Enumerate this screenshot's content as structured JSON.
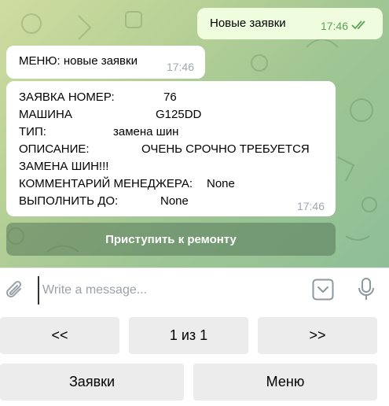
{
  "messages": {
    "outgoing": {
      "text": "Новые заявки",
      "time": "17:46"
    },
    "menu_message": {
      "text": "МЕНЮ: новые заявки",
      "time": "17:46"
    },
    "order_message": {
      "rows": [
        {
          "label": "ЗАЯВКА НОМЕР:",
          "value": "76"
        },
        {
          "label": "МАШИНА",
          "value": "G125DD"
        },
        {
          "label": "ТИП:",
          "value": "замена шин"
        },
        {
          "label": "ОПИСАНИЕ:",
          "value": "ОЧЕНЬ СРОЧНО ТРЕБУЕТСЯ"
        },
        {
          "label": "ЗАМЕНА ШИН!!!",
          "value": ""
        },
        {
          "label": "КОММЕНТАРИЙ МЕНЕДЖЕРА:",
          "value": "None"
        },
        {
          "label": "ВЫПОЛНИТЬ ДО:",
          "value": "None"
        }
      ],
      "time": "17:46"
    }
  },
  "inline_keyboard": {
    "start_repair_label": "Приступить к ремонту"
  },
  "composer": {
    "placeholder": "Write a message..."
  },
  "reply_keyboard": {
    "prev_label": "<<",
    "page_label": "1 из 1",
    "next_label": ">>",
    "orders_label": "Заявки",
    "menu_label": "Меню"
  },
  "icons": {
    "attach": "paperclip-icon",
    "keyboard": "keyboard-toggle-icon",
    "mic": "microphone-icon",
    "read": "double-check-icon"
  },
  "colors": {
    "outgoing_bubble": "#effdde",
    "incoming_bubble": "#ffffff",
    "check_green": "#5ba35a",
    "inline_button": "#56785a"
  }
}
